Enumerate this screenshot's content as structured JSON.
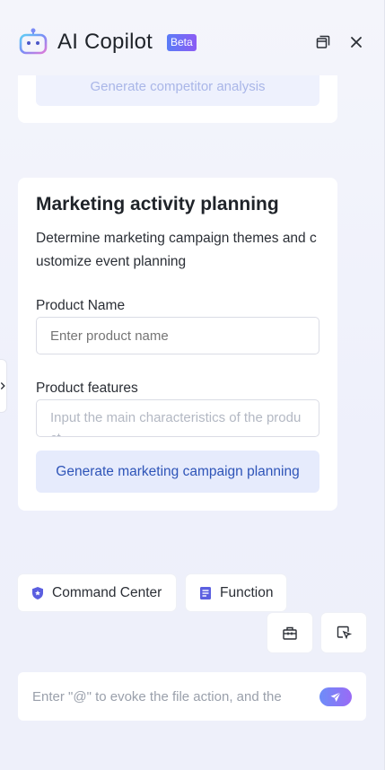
{
  "header": {
    "title": "AI Copilot",
    "badge": "Beta",
    "logo_icon": "robot-logo-icon",
    "actions": [
      "window-restore-icon",
      "close-icon"
    ]
  },
  "prev_card": {
    "button_label": "Generate competitor analysis"
  },
  "card": {
    "title": "Marketing activity planning",
    "description": "Determine marketing campaign themes and customize event planning",
    "product_name": {
      "label": "Product Name",
      "placeholder": "Enter product name",
      "value": ""
    },
    "product_features": {
      "label": "Product features",
      "placeholder": "Input the main characteristics of the product",
      "value": ""
    },
    "generate_label": "Generate marketing campaign planning"
  },
  "bottom": {
    "command_center_label": "Command Center",
    "function_label": "Function",
    "tool_icons": [
      "briefcase-icon",
      "cursor-select-icon"
    ]
  },
  "chat": {
    "placeholder": "Enter \"@\" to evoke the file action, and the",
    "send_icon": "send-icon"
  },
  "colors": {
    "accent": "#2e54b8",
    "badge_gradient_start": "#5a7cf7",
    "badge_gradient_end": "#8c5cf4",
    "icon_purple": "#5b5fe0"
  }
}
